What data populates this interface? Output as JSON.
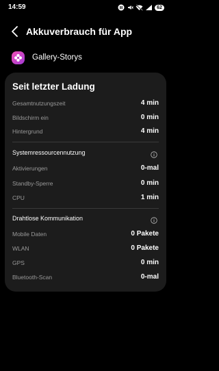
{
  "status_bar": {
    "time": "14:59",
    "battery": "62"
  },
  "header": {
    "title": "Akkuverbrauch für App"
  },
  "app": {
    "name": "Gallery-Storys"
  },
  "card": {
    "title": "Seit letzter Ladung",
    "usage_rows": [
      {
        "label": "Gesamtnutzungszeit",
        "value": "4 min"
      },
      {
        "label": "Bildschirm ein",
        "value": "0 min"
      },
      {
        "label": "Hintergrund",
        "value": "4 min"
      }
    ],
    "system_section": {
      "title": "Systemressourcennutzung",
      "rows": [
        {
          "label": "Aktivierungen",
          "value": "0-mal"
        },
        {
          "label": "Standby-Sperre",
          "value": "0 min"
        },
        {
          "label": "CPU",
          "value": "1 min"
        }
      ]
    },
    "wireless_section": {
      "title": "Drahtlose Kommunikation",
      "rows": [
        {
          "label": "Mobile Daten",
          "value": "0 Pakete"
        },
        {
          "label": "WLAN",
          "value": "0 Pakete"
        },
        {
          "label": "GPS",
          "value": "0 min"
        },
        {
          "label": "Bluetooth-Scan",
          "value": "0-mal"
        }
      ]
    }
  }
}
